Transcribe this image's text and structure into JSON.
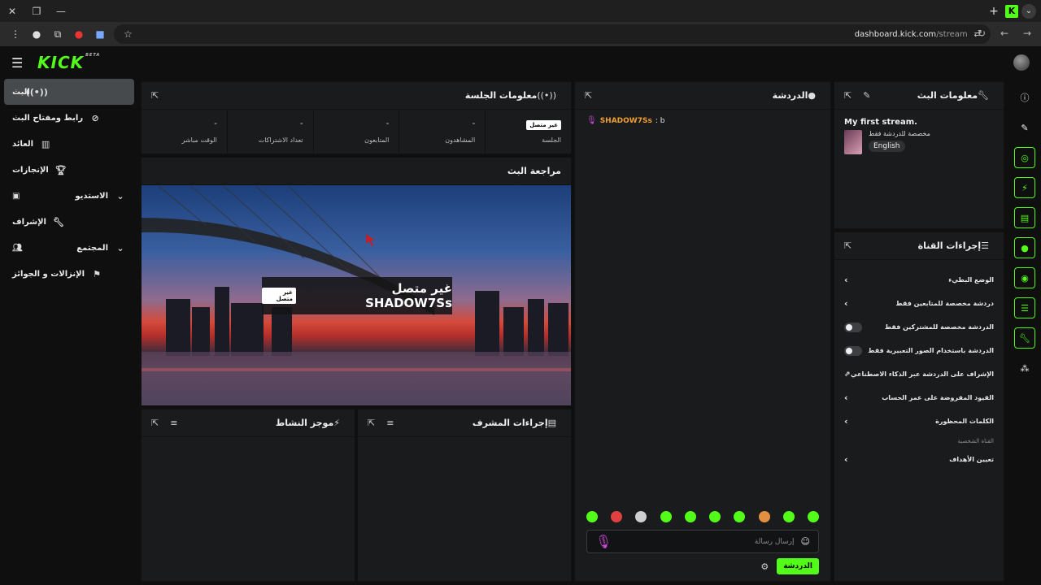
{
  "browser": {
    "url_host": "dashboard.kick.com",
    "url_path": "/stream",
    "tab_icon": "K"
  },
  "header": {
    "logo": "KICK",
    "logo_badge": "BETA"
  },
  "sidebar": {
    "items": [
      {
        "label": "البث",
        "icon": "broadcast-icon"
      },
      {
        "label": "رابط ومفتاح البث",
        "icon": "link-icon"
      },
      {
        "label": "العائد",
        "icon": "chart-icon"
      },
      {
        "label": "الإنجازات",
        "icon": "trophy-icon"
      },
      {
        "label": "الاستديو",
        "icon": "chevron-down-icon"
      },
      {
        "label": "الإشراف",
        "icon": "wrench-icon"
      },
      {
        "label": "المجتمع",
        "icon": "chevron-down-icon"
      },
      {
        "label": "الإنزالات و الجوائز",
        "icon": "gift-icon"
      }
    ]
  },
  "session": {
    "title": "معلومات الجلسة",
    "status_badge": "غير متصل",
    "stats": [
      {
        "value": "",
        "label": "الجلسة"
      },
      {
        "value": "-",
        "label": "المشاهدون"
      },
      {
        "value": "-",
        "label": "المتابعون"
      },
      {
        "value": "-",
        "label": "تعداد الاشتراكات"
      },
      {
        "value": "-",
        "label": "الوقت مباشر"
      }
    ]
  },
  "preview": {
    "title": "مراجعة البث",
    "overlay_text": "غير متصل SHADOW7Ss",
    "overlay_badge": "غير متصل"
  },
  "activity": {
    "title": "موجز النشاط"
  },
  "mod_actions": {
    "title": "إجراءات المشرف"
  },
  "chat": {
    "title": "الدردشة",
    "messages": [
      {
        "user": "SHADOW7Ss",
        "text": ": b"
      }
    ],
    "input_placeholder": "إرسال رسالة",
    "send_label": "الدردشة"
  },
  "stream_info": {
    "title": "معلومات البث",
    "stream_title": "My first stream.",
    "category": "مخصصة للدردشة فقط",
    "language": "English"
  },
  "channel_actions": {
    "title": "إجراءات القناة",
    "items": [
      {
        "label": "الوضع البطيء",
        "type": "chevron"
      },
      {
        "label": "دردشة مخصصة للمتابعين فقط",
        "type": "chevron"
      },
      {
        "label": "الدردشة مخصصة للمشتركين فقط",
        "type": "toggle"
      },
      {
        "label": "الدردشة باستخدام الصور التعبيرية فقط",
        "type": "toggle"
      },
      {
        "label": "الإشراف على الدردشة عبر الذكاء الاصطناعي",
        "type": "external"
      },
      {
        "label": "القيود المفروضة على عمر الحساب",
        "type": "chevron"
      },
      {
        "label": "الكلمات المحظورة",
        "type": "chevron"
      }
    ],
    "section_label": "القناة الشخصية",
    "section_items": [
      {
        "label": "تعيين الأهداف",
        "type": "chevron"
      }
    ]
  },
  "colors": {
    "accent": "#53fc18",
    "bg": "#0f0f10",
    "panel": "#1a1b1c"
  }
}
